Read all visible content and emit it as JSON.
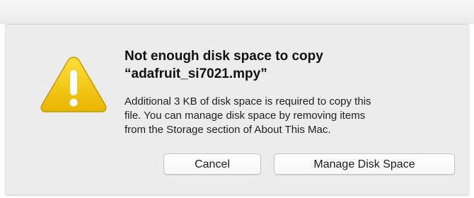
{
  "alert": {
    "icon": "warning-icon",
    "title_lines": [
      "Not enough disk space to copy",
      "“adafruit_si7021.mpy”"
    ],
    "message_lines": [
      "Additional 3 KB of disk space is required to copy this",
      "file. You can manage disk space by removing items",
      "from the Storage section of About This Mac."
    ],
    "buttons": {
      "cancel": "Cancel",
      "manage": "Manage Disk Space"
    }
  },
  "colors": {
    "warning_fill": "#f5c400",
    "dialog_background": "#ececec"
  }
}
